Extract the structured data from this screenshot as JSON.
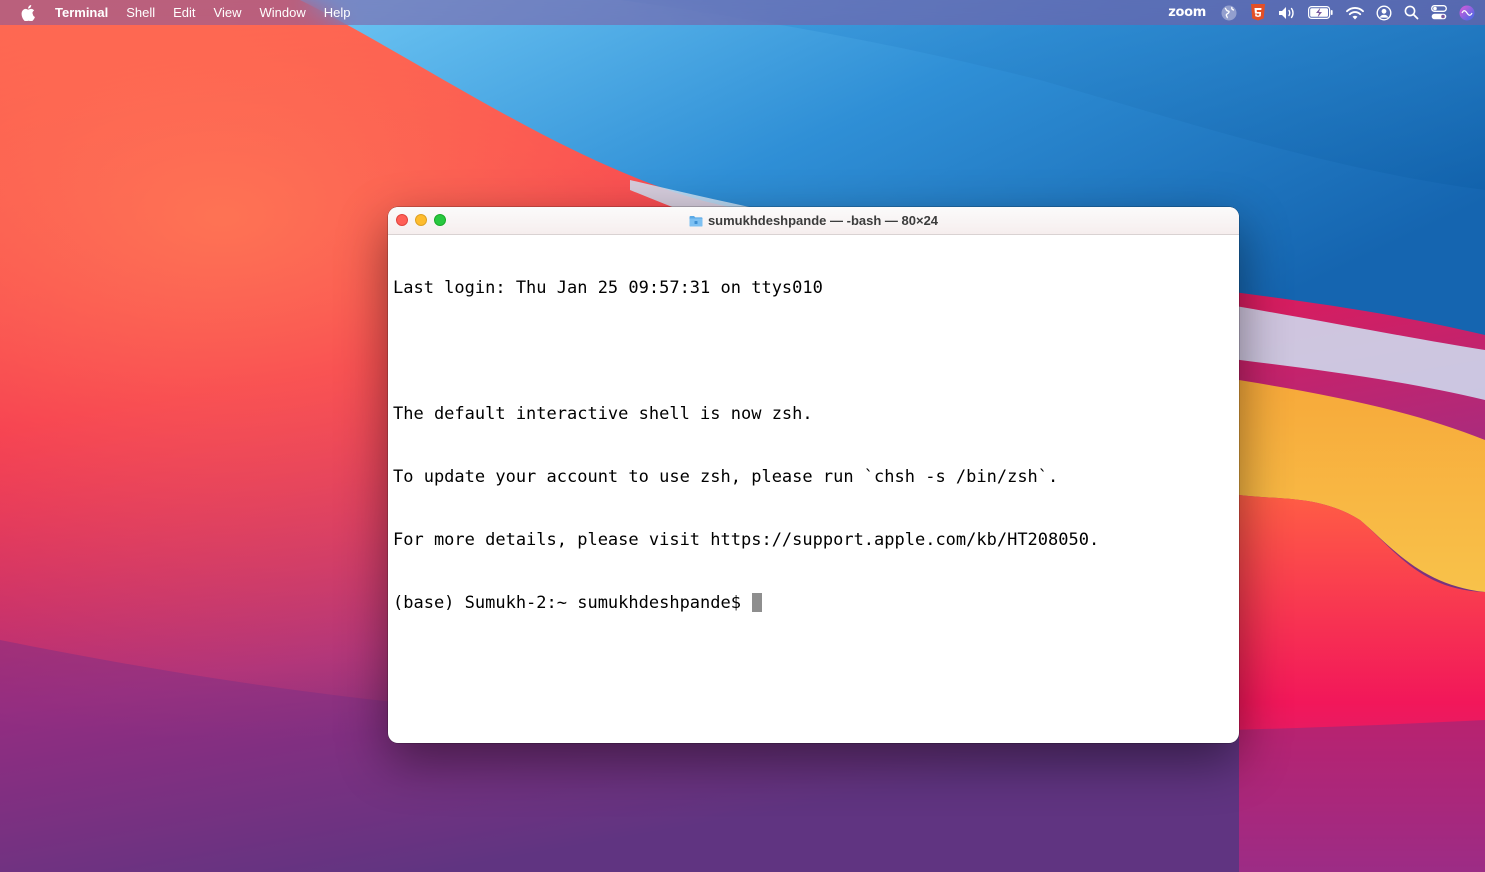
{
  "menubar": {
    "apple_icon": "apple-icon",
    "app_name": "Terminal",
    "items": [
      "Shell",
      "Edit",
      "View",
      "Window",
      "Help"
    ],
    "status": {
      "zoom_label": "zoom",
      "icons": [
        "globe-icon",
        "html5-icon",
        "volume-icon",
        "battery-charging-icon",
        "wifi-icon",
        "user-account-icon",
        "spotlight-search-icon",
        "control-center-icon",
        "siri-icon"
      ]
    }
  },
  "terminal": {
    "title": "sumukhdeshpande — -bash — 80×24",
    "title_icon": "folder-icon",
    "lines": [
      "Last login: Thu Jan 25 09:57:31 on ttys010",
      "",
      "The default interactive shell is now zsh.",
      "To update your account to use zsh, please run `chsh -s /bin/zsh`.",
      "For more details, please visit https://support.apple.com/kb/HT208050."
    ],
    "prompt": "(base) Sumukh-2:~ sumukhdeshpande$ "
  },
  "colors": {
    "close": "#ff5f57",
    "minimize": "#febc2e",
    "maximize": "#28c840",
    "cursor": "#8e8e8e"
  }
}
